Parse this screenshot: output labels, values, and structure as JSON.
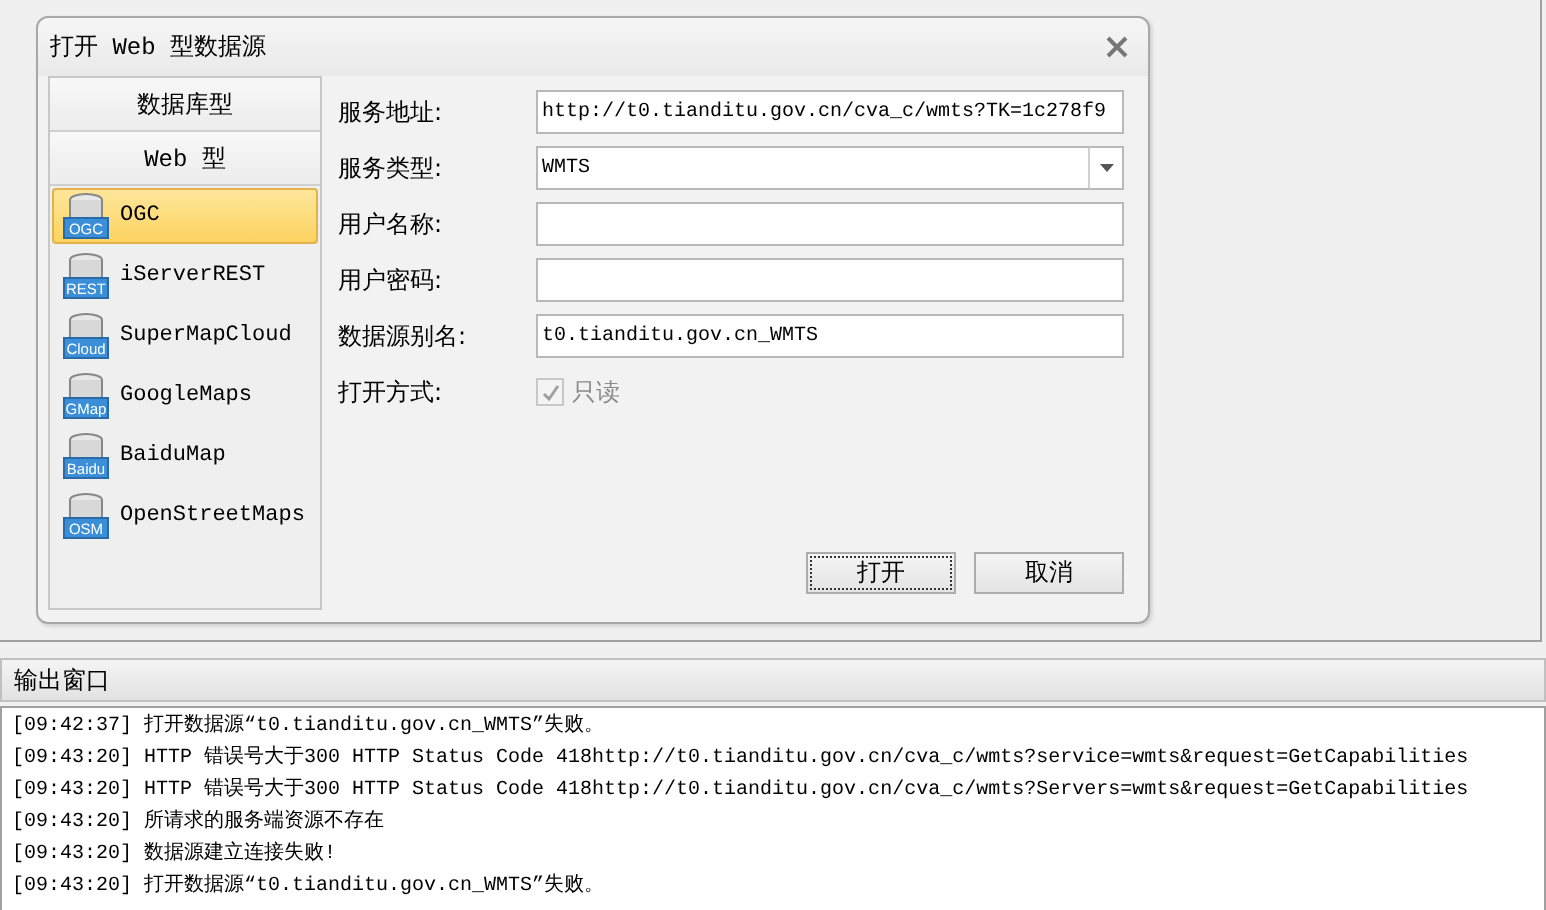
{
  "dialog": {
    "title": "打开 Web 型数据源"
  },
  "categories": [
    {
      "label": "数据库型"
    },
    {
      "label": "Web 型"
    }
  ],
  "sources": [
    {
      "label": "OGC",
      "badge": "OGC",
      "selected": true
    },
    {
      "label": "iServerREST",
      "badge": "REST",
      "selected": false
    },
    {
      "label": "SuperMapCloud",
      "badge": "Cloud",
      "selected": false
    },
    {
      "label": "GoogleMaps",
      "badge": "GMap",
      "selected": false
    },
    {
      "label": "BaiduMap",
      "badge": "Baidu",
      "selected": false
    },
    {
      "label": "OpenStreetMaps",
      "badge": "OSM",
      "selected": false
    }
  ],
  "fields": [
    {
      "kind": "text",
      "label": "服务地址:",
      "value": "http://t0.tianditu.gov.cn/cva_c/wmts?TK=1c278f9"
    },
    {
      "kind": "combo",
      "label": "服务类型:",
      "value": "WMTS"
    },
    {
      "kind": "text",
      "label": "用户名称:"
    },
    {
      "kind": "password",
      "label": "用户密码:"
    },
    {
      "kind": "text",
      "label": "数据源别名:",
      "value": "t0.tianditu.gov.cn_WMTS"
    },
    {
      "kind": "checkbox",
      "label": "打开方式:",
      "option": "只读",
      "checked": true,
      "disabled": true
    }
  ],
  "buttons": [
    {
      "label": "打开",
      "focused": true
    },
    {
      "label": "取消",
      "focused": false
    }
  ],
  "output": {
    "title": "输出窗口",
    "lines": [
      "[09:42:37] 打开数据源“t0.tianditu.gov.cn_WMTS”失败。",
      "[09:43:20] HTTP 错误号大于300 HTTP Status Code 418http://t0.tianditu.gov.cn/cva_c/wmts?service=wmts&request=GetCapabilities",
      "[09:43:20] HTTP 错误号大于300 HTTP Status Code 418http://t0.tianditu.gov.cn/cva_c/wmts?Servers=wmts&request=GetCapabilities",
      "[09:43:20] 所请求的服务端资源不存在",
      "[09:43:20] 数据源建立连接失败!",
      "[09:43:20] 打开数据源“t0.tianditu.gov.cn_WMTS”失败。"
    ]
  }
}
